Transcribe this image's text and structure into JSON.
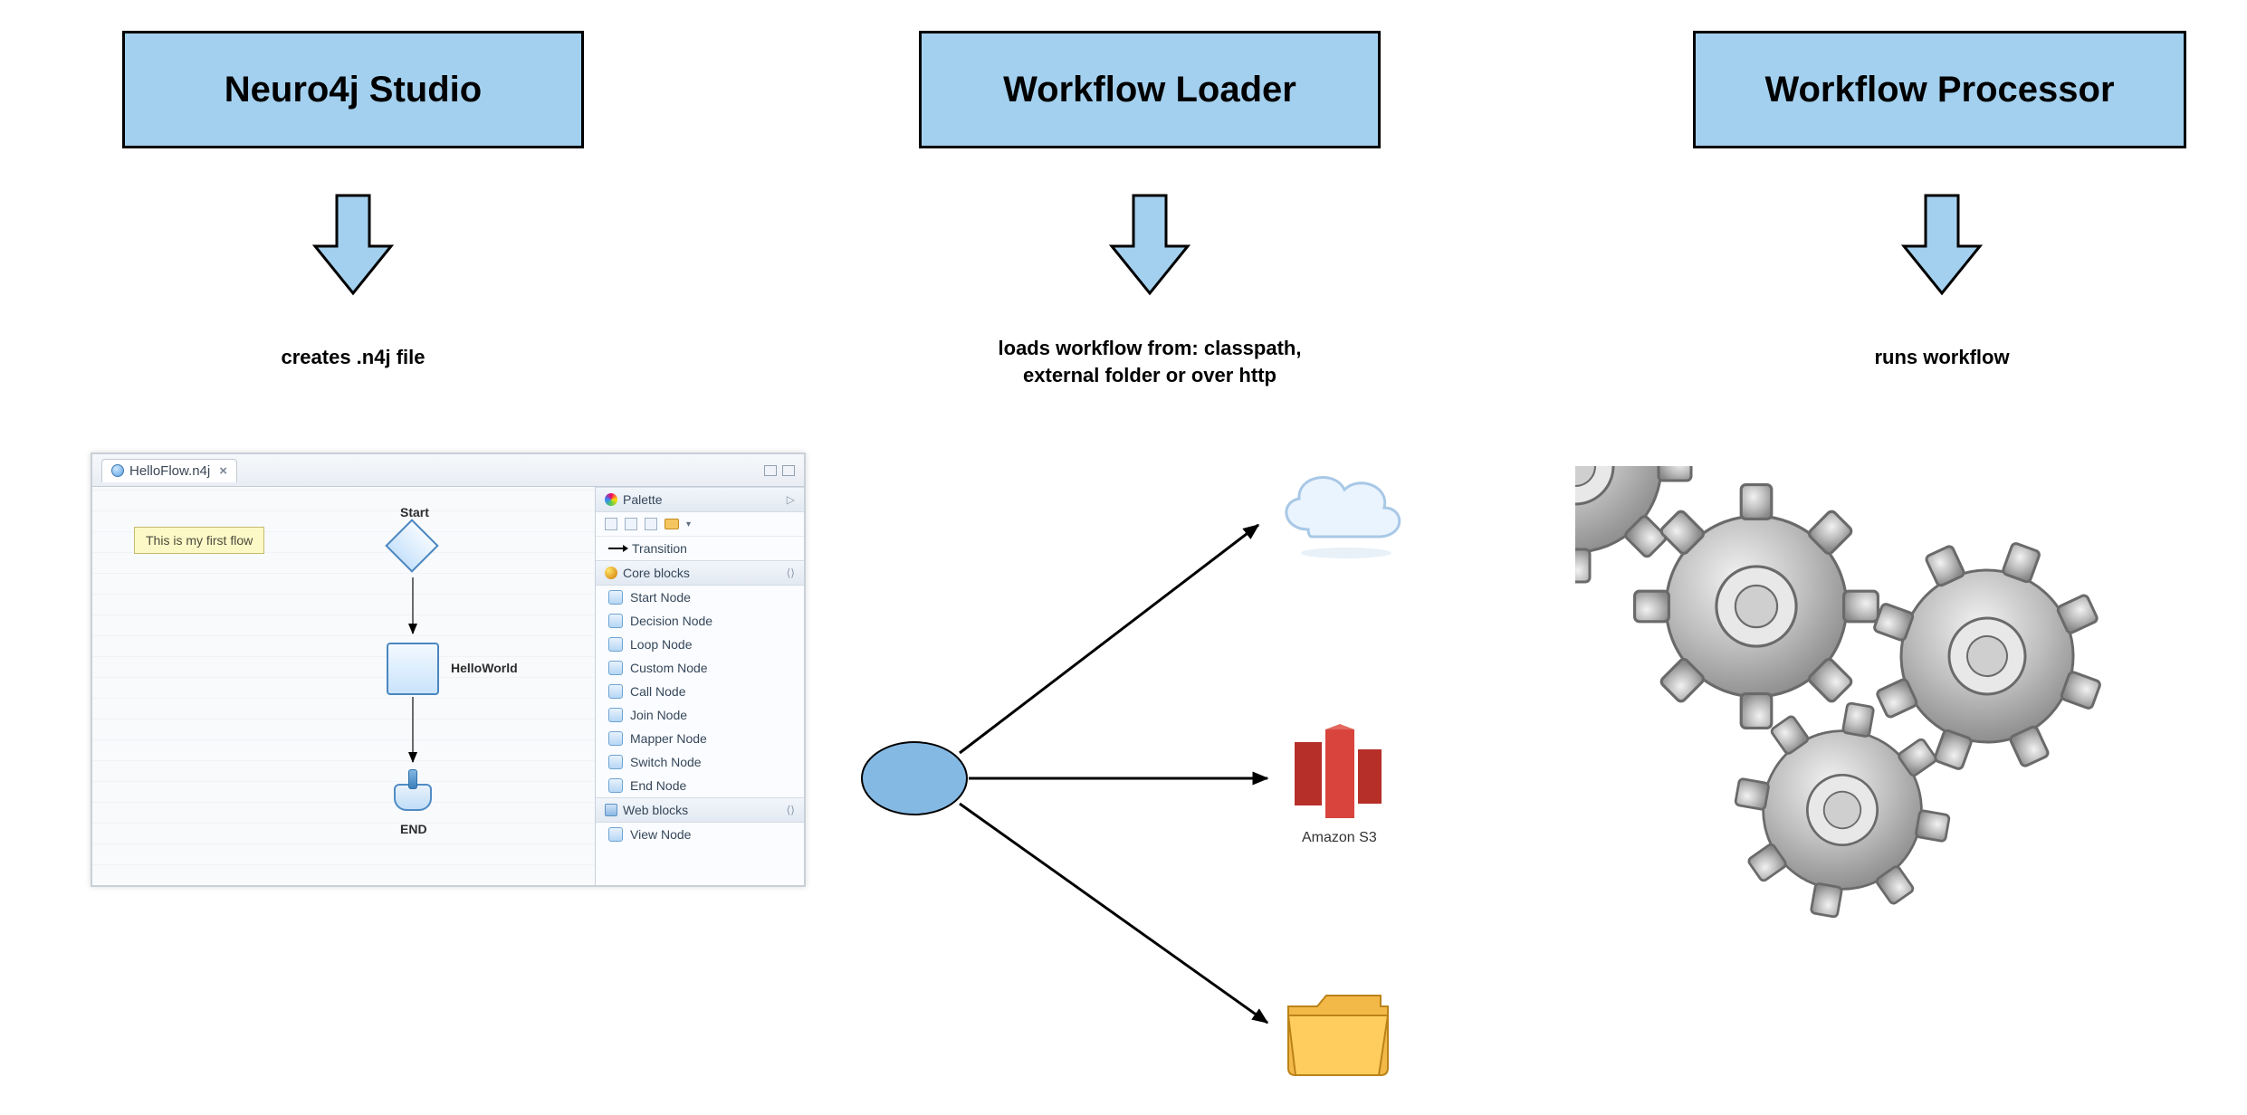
{
  "columns": {
    "studio": {
      "title": "Neuro4j Studio",
      "caption": "creates .n4j file"
    },
    "loader": {
      "title": "Workflow Loader",
      "caption_line1": "loads workflow from: classpath,",
      "caption_line2": "external folder or over http"
    },
    "processor": {
      "title": "Workflow Processor",
      "caption": "runs workflow"
    }
  },
  "studio_panel": {
    "tab_name": "HelloFlow.n4j",
    "note_text": "This is my first flow",
    "labels": {
      "start": "Start",
      "hello": "HelloWorld",
      "end": "END"
    }
  },
  "palette": {
    "header": "Palette",
    "transition": "Transition",
    "section_core": "Core blocks",
    "section_web": "Web blocks",
    "items_core": [
      "Start Node",
      "Decision Node",
      "Loop Node",
      "Custom Node",
      "Call Node",
      "Join Node",
      "Mapper Node",
      "Switch Node",
      "End Node"
    ],
    "items_web": [
      "View Node"
    ]
  },
  "loader_targets": {
    "s3_label": "Amazon S3"
  },
  "colors": {
    "box_fill": "#a3d0ee",
    "arrow_fill": "#a3d0ee"
  }
}
